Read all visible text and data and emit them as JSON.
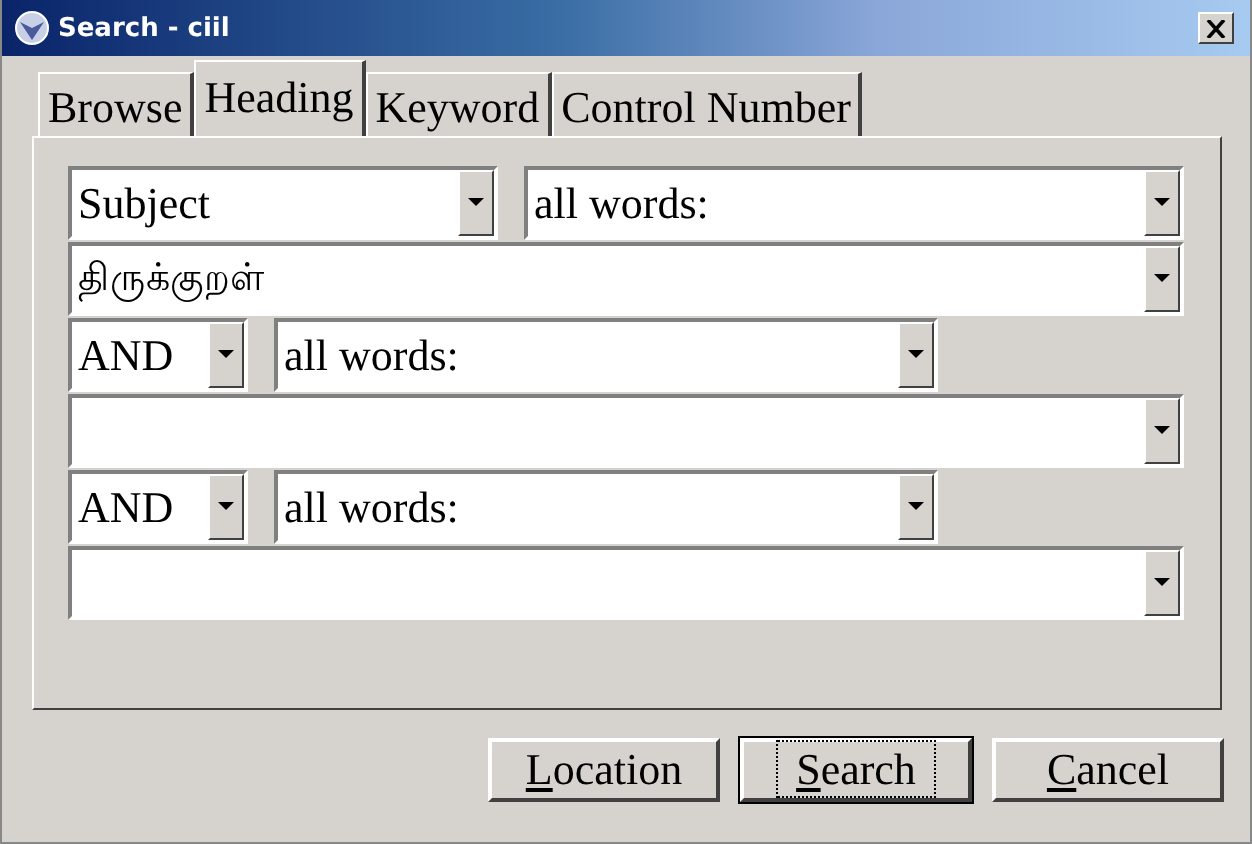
{
  "window": {
    "title": "Search - ciil"
  },
  "tabs": [
    {
      "label": "Browse",
      "selected": false
    },
    {
      "label": "Heading",
      "selected": true
    },
    {
      "label": "Keyword",
      "selected": false
    },
    {
      "label": "Control Number",
      "selected": false
    }
  ],
  "query_rows": [
    {
      "kind": "field_match",
      "field": "Subject",
      "match": "all words:"
    },
    {
      "kind": "term",
      "value": "திருக்குறள்"
    },
    {
      "kind": "operator_match",
      "operator": "AND",
      "match": "all words:"
    },
    {
      "kind": "term"
    },
    {
      "kind": "operator_match",
      "operator": "AND",
      "match": "all words:"
    },
    {
      "kind": "term"
    }
  ],
  "buttons": [
    {
      "label": "Location",
      "access_key_underlined": true,
      "default": false
    },
    {
      "label": "Search",
      "access_key_underlined": true,
      "default": true
    },
    {
      "label": "Cancel",
      "access_key_underlined": true,
      "default": false
    }
  ]
}
